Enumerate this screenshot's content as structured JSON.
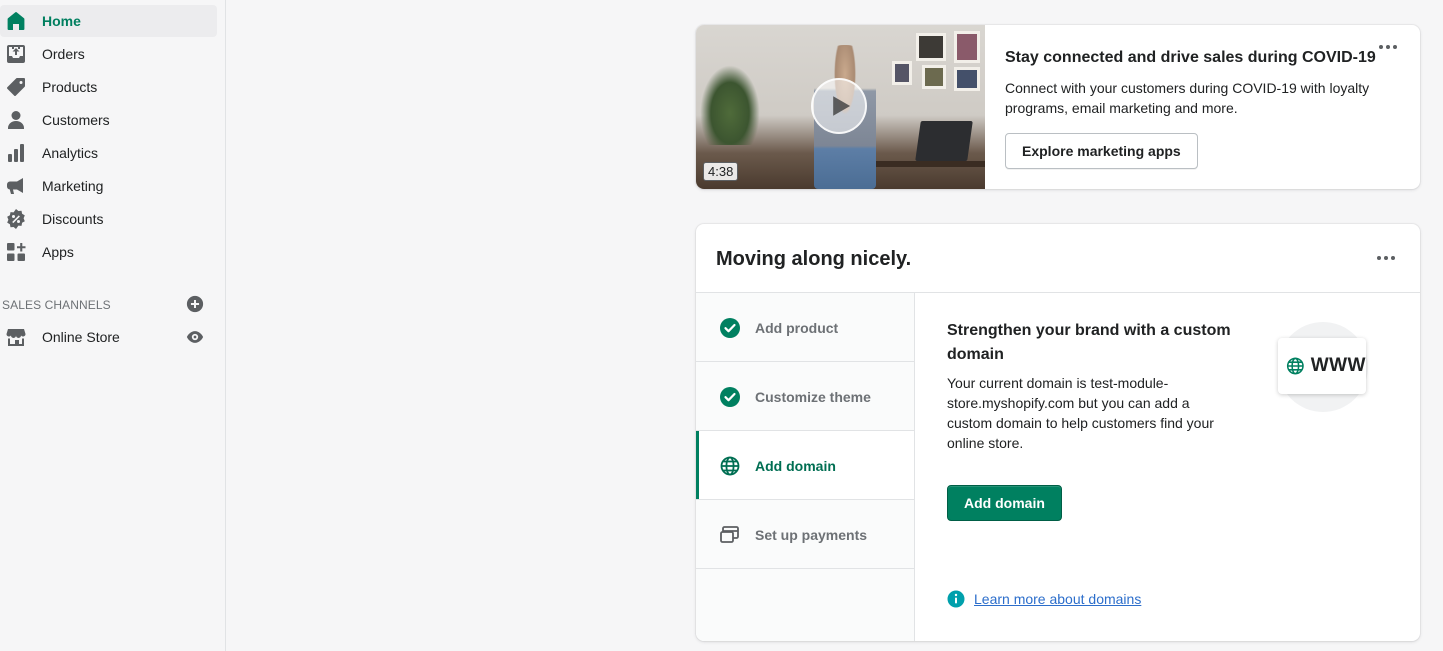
{
  "sidebar": {
    "items": [
      {
        "label": "Home",
        "icon": "home-icon",
        "active": true
      },
      {
        "label": "Orders",
        "icon": "orders-icon"
      },
      {
        "label": "Products",
        "icon": "tag-icon"
      },
      {
        "label": "Customers",
        "icon": "person-icon"
      },
      {
        "label": "Analytics",
        "icon": "bar-chart-icon"
      },
      {
        "label": "Marketing",
        "icon": "megaphone-icon"
      },
      {
        "label": "Discounts",
        "icon": "discount-icon"
      },
      {
        "label": "Apps",
        "icon": "apps-icon"
      }
    ],
    "sales_channels_heading": "SALES CHANNELS",
    "channels": [
      {
        "label": "Online Store",
        "icon": "store-icon"
      }
    ]
  },
  "covid_card": {
    "video_duration": "4:38",
    "title": "Stay connected and drive sales during COVID-19",
    "description": "Connect with your customers during COVID-19 with loyalty programs, email marketing and more.",
    "button_label": "Explore marketing apps"
  },
  "setup_card": {
    "title": "Moving along nicely.",
    "steps": [
      {
        "label": "Add product",
        "status": "complete"
      },
      {
        "label": "Customize theme",
        "status": "complete"
      },
      {
        "label": "Add domain",
        "status": "active"
      },
      {
        "label": "Set up payments",
        "status": "incomplete"
      }
    ],
    "detail": {
      "title": "Strengthen your brand with a custom domain",
      "description": "Your current domain is test-module-store.myshopify.com but you can add a custom domain to help customers find your online store.",
      "button_label": "Add domain",
      "link_text": "Learn more about domains",
      "illustration_text": "WWW"
    }
  },
  "colors": {
    "accent": "#008060",
    "link": "#2c6ecb",
    "info": "#00a0ac"
  }
}
